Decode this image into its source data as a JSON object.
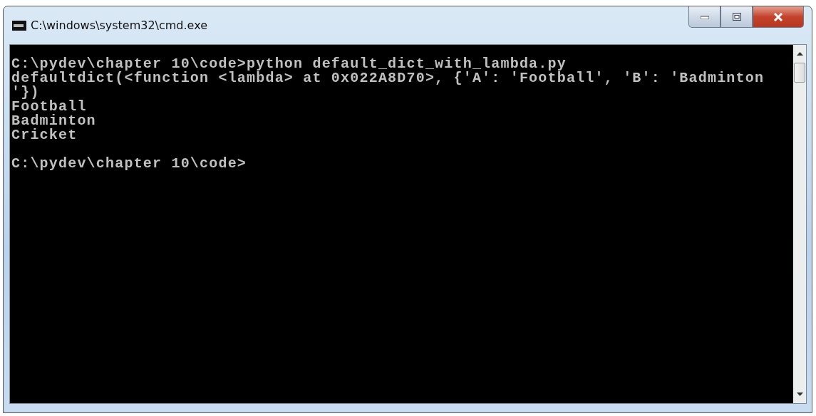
{
  "window": {
    "title": "C:\\windows\\system32\\cmd.exe"
  },
  "console": {
    "blocks": [
      [
        "C:\\pydev\\chapter 10\\code>python default_dict_with_lambda.py",
        "defaultdict(<function <lambda> at 0x022A8D70>, {'A': 'Football', 'B': 'Badminton",
        "'})",
        "Football",
        "Badminton",
        "Cricket"
      ],
      [
        "C:\\pydev\\chapter 10\\code>"
      ]
    ]
  }
}
